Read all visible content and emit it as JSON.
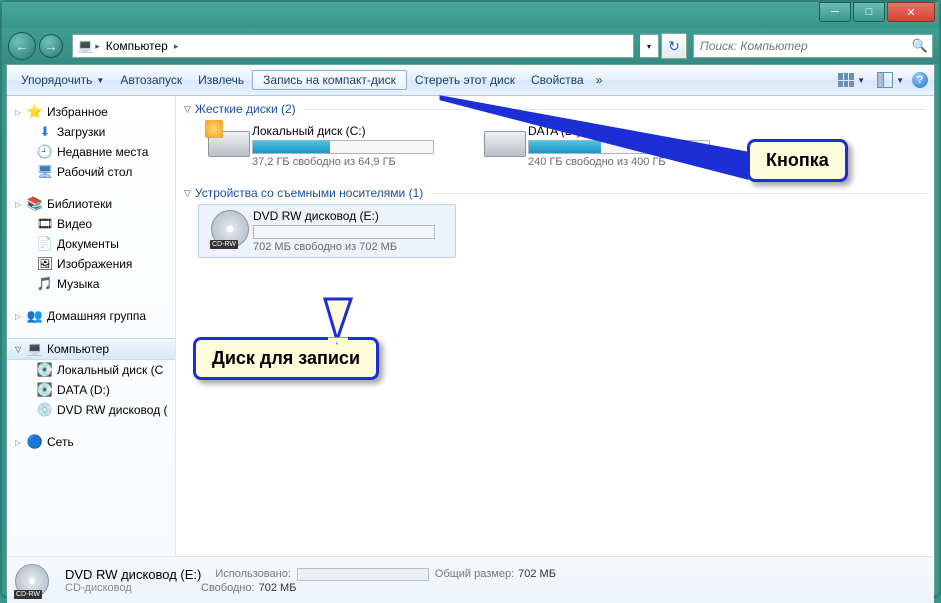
{
  "breadcrumb": {
    "root_icon": "▣",
    "location": "Компьютер"
  },
  "search": {
    "placeholder": "Поиск: Компьютер"
  },
  "toolbar": {
    "organize": "Упорядочить",
    "autoplay": "Автозапуск",
    "eject": "Извлечь",
    "burn": "Запись на компакт-диск",
    "erase": "Стереть этот диск",
    "properties": "Свойства"
  },
  "sidebar": {
    "favorites": {
      "label": "Избранное",
      "items": [
        {
          "icon": "⬇",
          "label": "Загрузки",
          "color": "#2d7dd2"
        },
        {
          "icon": "🕘",
          "label": "Недавние места",
          "color": "#a56f2e"
        },
        {
          "icon": "🖥",
          "label": "Рабочий стол",
          "color": "#3a7ac0"
        }
      ]
    },
    "libraries": {
      "label": "Библиотеки",
      "items": [
        {
          "icon": "🎞",
          "label": "Видео",
          "color": "#3a7ac0"
        },
        {
          "icon": "📄",
          "label": "Документы",
          "color": "#8a6d3b"
        },
        {
          "icon": "🖼",
          "label": "Изображения",
          "color": "#3a7ac0"
        },
        {
          "icon": "🎵",
          "label": "Музыка",
          "color": "#c08a2e"
        }
      ]
    },
    "homegroup": {
      "label": "Домашняя группа",
      "icon": "👥"
    },
    "computer": {
      "label": "Компьютер",
      "icon": "💻",
      "items": [
        {
          "icon": "💽",
          "label": "Локальный диск (C"
        },
        {
          "icon": "💽",
          "label": "DATA (D:)"
        },
        {
          "icon": "💿",
          "label": "DVD RW дисковод ("
        }
      ]
    },
    "network": {
      "label": "Сеть",
      "icon": "🔵"
    }
  },
  "categories": {
    "hdd": {
      "header": "Жесткие диски (2)",
      "drives": [
        {
          "name": "Локальный диск (C:)",
          "free": "37,2 ГБ свободно из 64,9 ГБ",
          "used_pct": 43
        },
        {
          "name": "DATA (D:)",
          "free": "240 ГБ свободно из 400 ГБ",
          "used_pct": 40
        }
      ]
    },
    "removable": {
      "header": "Устройства со съемными носителями (1)",
      "drives": [
        {
          "name": "DVD RW дисковод (E:)",
          "free": "702 МБ свободно из 702 МБ",
          "used_pct": 0,
          "badge": "CD-RW"
        }
      ]
    }
  },
  "status": {
    "name": "DVD RW дисковод (E:)",
    "type": "CD-дисковод",
    "used_label": "Использовано:",
    "free_label": "Свободно:",
    "free_value": "702 МБ",
    "total_label": "Общий размер:",
    "total_value": "702 МБ",
    "badge": "CD-RW"
  },
  "callouts": {
    "button": "Кнопка",
    "disc": "Диск для записи"
  }
}
